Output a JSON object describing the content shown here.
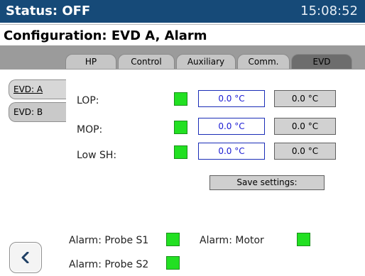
{
  "status_bar": {
    "status_text": "Status: OFF",
    "time": "15:08:52"
  },
  "config_bar": {
    "title": "Configuration: EVD A, Alarm"
  },
  "tabs": [
    "HP",
    "Control",
    "Auxiliary",
    "Comm.",
    "EVD"
  ],
  "side_tabs": [
    "EVD: A",
    "EVD: B"
  ],
  "rows": [
    {
      "label": "LOP:",
      "value": "0.0 °C",
      "readout": "0.0 °C"
    },
    {
      "label": "MOP:",
      "value": "0.0 °C",
      "readout": "0.0 °C"
    },
    {
      "label": "Low SH:",
      "value": "0.0 °C",
      "readout": "0.0 °C"
    }
  ],
  "save_label": "Save settings:",
  "alarms": [
    {
      "label": "Alarm: Probe S1"
    },
    {
      "label": "Alarm: Motor"
    },
    {
      "label": "Alarm: Probe S2"
    }
  ],
  "colors": {
    "status_bar": "#164a78",
    "led_green": "#22e022",
    "field_border": "#1a2db7"
  },
  "icons": {
    "back": "chevron-left-icon"
  }
}
